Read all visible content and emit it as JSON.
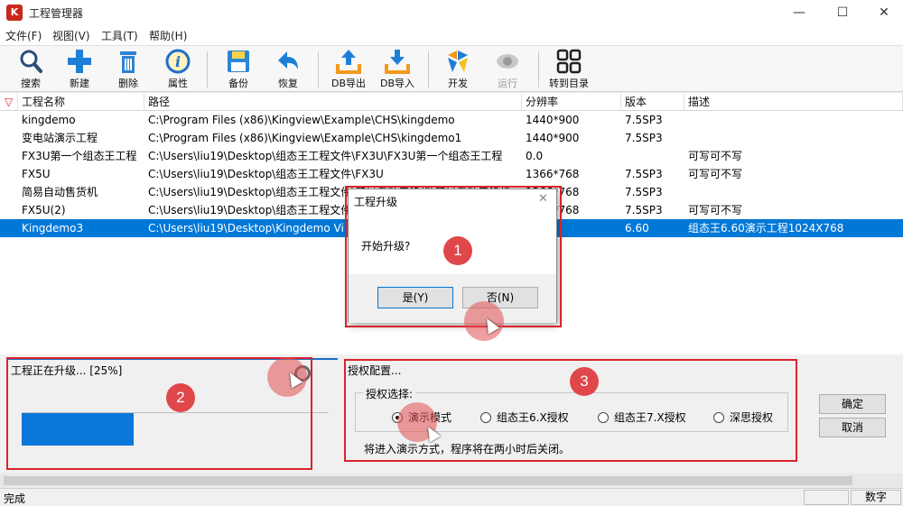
{
  "app": {
    "title": "工程管理器",
    "logo_text": "K"
  },
  "window_controls": {
    "minimize": "—",
    "maximize": "☐",
    "close": "✕"
  },
  "menu": [
    "文件(F)",
    "视图(V)",
    "工具(T)",
    "帮助(H)"
  ],
  "toolbar": [
    {
      "label": "搜索",
      "icon": "search-icon",
      "enabled": true
    },
    {
      "label": "新建",
      "icon": "plus-icon",
      "enabled": true
    },
    {
      "label": "删除",
      "icon": "trash-icon",
      "enabled": true
    },
    {
      "label": "属性",
      "icon": "info-icon",
      "enabled": true
    },
    {
      "label": "备份",
      "icon": "floppy-icon",
      "enabled": true
    },
    {
      "label": "恢复",
      "icon": "undo-icon",
      "enabled": true
    },
    {
      "label": "DB导出",
      "icon": "upload-icon",
      "enabled": true
    },
    {
      "label": "DB导入",
      "icon": "download-icon",
      "enabled": true
    },
    {
      "label": "开发",
      "icon": "develop-icon",
      "enabled": true
    },
    {
      "label": "运行",
      "icon": "run-icon",
      "enabled": false
    },
    {
      "label": "转到目录",
      "icon": "grid-icon",
      "enabled": true
    }
  ],
  "table": {
    "columns": [
      "工程名称",
      "路径",
      "分辨率",
      "版本",
      "描述"
    ],
    "rows": [
      {
        "name": "kingdemo",
        "path": "C:\\Program Files (x86)\\Kingview\\Example\\CHS\\kingdemo",
        "resolution": "1440*900",
        "version": "7.5SP3",
        "desc": ""
      },
      {
        "name": "变电站演示工程",
        "path": "C:\\Program Files (x86)\\Kingview\\Example\\CHS\\kingdemo1",
        "resolution": "1440*900",
        "version": "7.5SP3",
        "desc": ""
      },
      {
        "name": "FX3U第一个组态王工程",
        "path": "C:\\Users\\liu19\\Desktop\\组态王工程文件\\FX3U\\FX3U第一个组态王工程",
        "resolution": "0.0",
        "version": "",
        "desc": "可写可不写"
      },
      {
        "name": "FX5U",
        "path": "C:\\Users\\liu19\\Desktop\\组态王工程文件\\FX3U",
        "resolution": "1366*768",
        "version": "7.5SP3",
        "desc": "可写可不写"
      },
      {
        "name": "简易自动售货机",
        "path": "C:\\Users\\liu19\\Desktop\\组态王工程文件\\简易自动售货机\\简易自动售货机",
        "resolution": "1366*768",
        "version": "7.5SP3",
        "desc": ""
      },
      {
        "name": "FX5U(2)",
        "path": "C:\\Users\\liu19\\Desktop\\组态王工程文件\\FX5U",
        "resolution": "1366*768",
        "version": "7.5SP3",
        "desc": "可写可不写"
      },
      {
        "name": "Kingdemo3",
        "path": "C:\\Users\\liu19\\Desktop\\Kingdemo Vi",
        "resolution": "768",
        "version": "6.60",
        "desc": "组态王6.60演示工程1024X768"
      }
    ],
    "selected_index": 6
  },
  "dialog": {
    "title": "工程升级",
    "message": "开始升级?",
    "yes_label": "是(Y)",
    "no_label": "否(N)"
  },
  "progress": {
    "text": "工程正在升级... [25%]",
    "percent": 25
  },
  "license": {
    "title": "授权配置...",
    "group_label": "授权选择:",
    "options": [
      "演示模式",
      "组态王6.X授权",
      "组态王7.X授权",
      "深思授权"
    ],
    "selected_index": 0,
    "note": "将进入演示方式，程序将在两小时后关闭。",
    "ok_label": "确定",
    "cancel_label": "取消"
  },
  "annotations": [
    "1",
    "2",
    "3"
  ],
  "status": {
    "text": "完成",
    "pane_label": "数字"
  },
  "colors": {
    "accent": "#0078d7",
    "annotation_red": "#d9232a",
    "progress_blue": "#0a78d8"
  }
}
